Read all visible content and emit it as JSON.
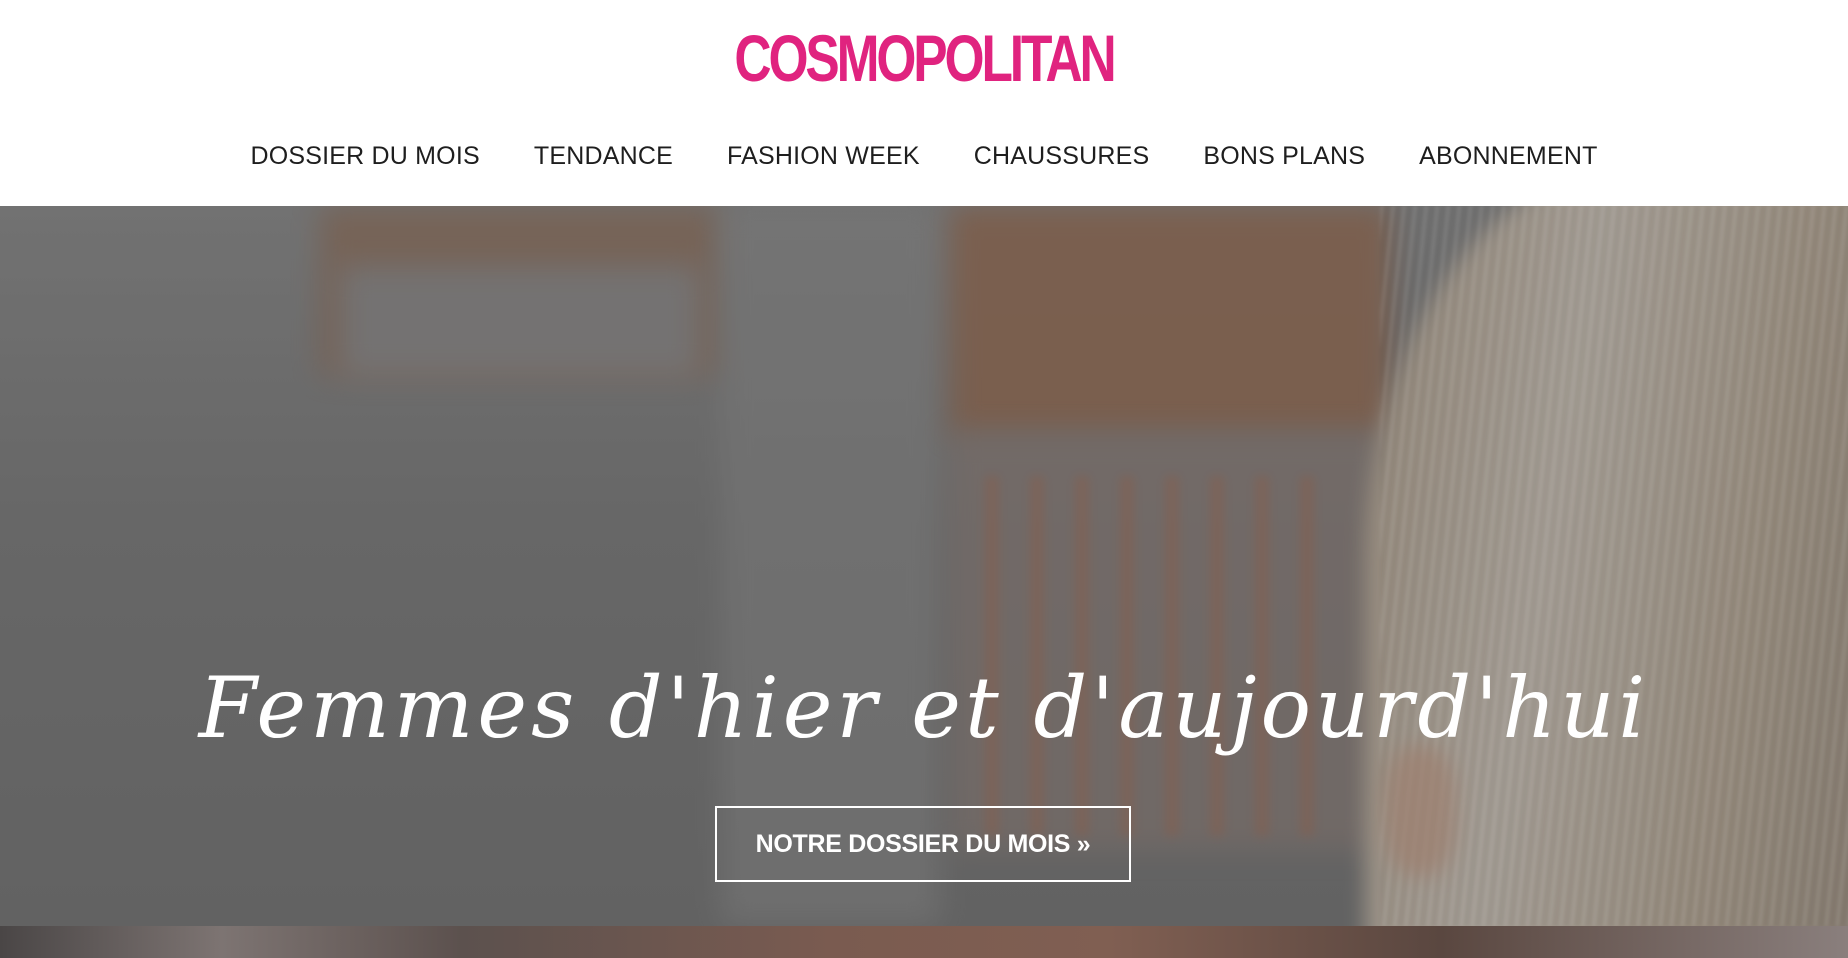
{
  "header": {
    "logo_text": "COSMOPOLITAN",
    "nav": [
      {
        "label": "DOSSIER DU MOIS"
      },
      {
        "label": "TENDANCE"
      },
      {
        "label": "FASHION WEEK"
      },
      {
        "label": "CHAUSSURES"
      },
      {
        "label": "BONS PLANS"
      },
      {
        "label": "ABONNEMENT"
      }
    ]
  },
  "hero": {
    "headline": "Femmes d'hier et d'aujourd'hui",
    "cta_label": "NOTRE DOSSIER DU MOIS »"
  },
  "colors": {
    "brand": "#e0237f",
    "nav_text": "#1e1e1e",
    "hero_text": "#ffffff"
  }
}
